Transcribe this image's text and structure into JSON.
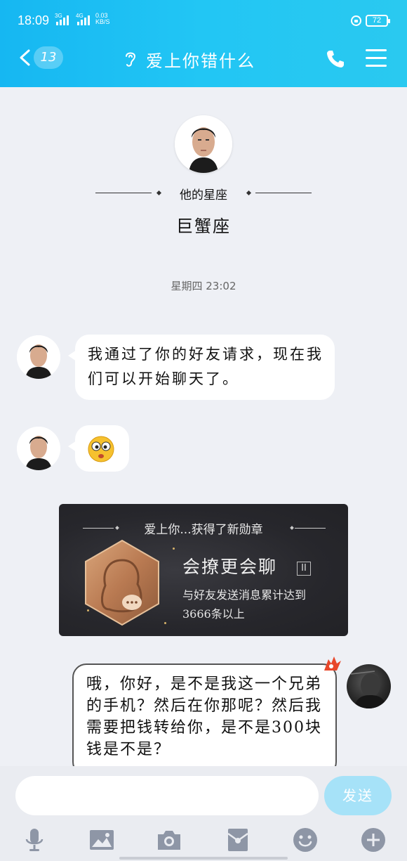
{
  "status_bar": {
    "time": "18:09",
    "net1": "3G",
    "net2": "4G",
    "speed_value": "0.03",
    "speed_unit": "KB/S",
    "battery": "72"
  },
  "nav": {
    "unread_count": "13",
    "title": "爱上你错什么"
  },
  "profile": {
    "zodiac_label": "他的星座",
    "zodiac_value": "巨蟹座"
  },
  "timestamp": "星期四 23:02",
  "messages": [
    {
      "text": "我通过了你的好友请求，现在我们可以开始聊天了。"
    },
    {
      "emoji": "surprised-emoji"
    }
  ],
  "medal": {
    "headline": "爱上你...获得了新勋章",
    "name": "会撩更会聊",
    "level": "II",
    "description": "与好友发送消息累计达到3666条以上"
  },
  "sent_message": {
    "text": "哦，你好，是不是我这一个兄弟的手机？然后在你那呢？然后我需要把钱转给你，是不是300块钱是不是？"
  },
  "input": {
    "placeholder": "",
    "send_label": "发送"
  },
  "colors": {
    "header": "#1fbff3",
    "send_button": "#a6e2f8",
    "medal_bg": "#27272c"
  },
  "toolbar_icons": [
    "microphone-icon",
    "image-icon",
    "camera-icon",
    "red-packet-icon",
    "emoji-icon",
    "plus-icon"
  ]
}
